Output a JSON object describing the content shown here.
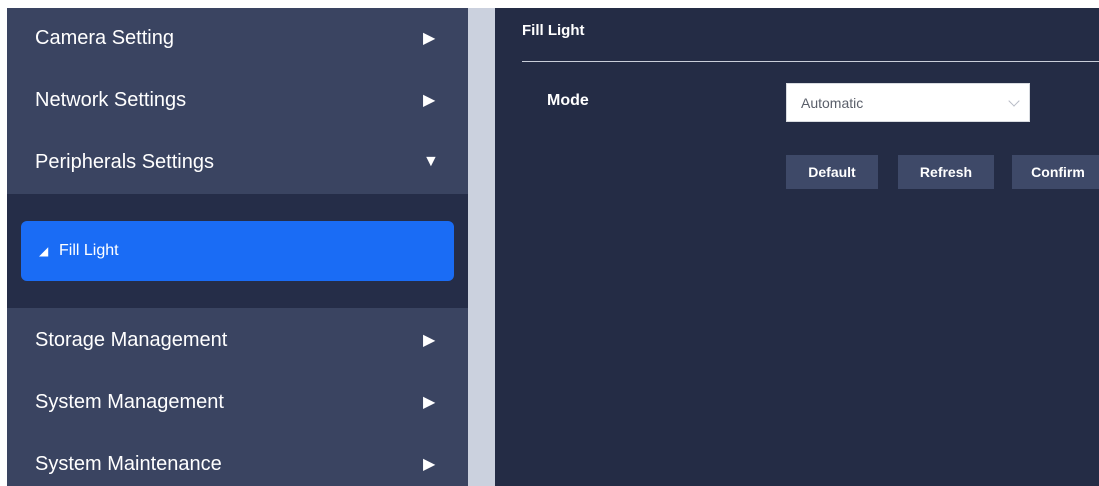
{
  "sidebar": {
    "items": [
      {
        "label": "Camera Setting",
        "arrow": "▶"
      },
      {
        "label": "Network Settings",
        "arrow": "▶"
      },
      {
        "label": "Peripherals Settings",
        "arrow": "▼"
      },
      {
        "label": "Storage Management",
        "arrow": "▶"
      },
      {
        "label": "System Management",
        "arrow": "▶"
      },
      {
        "label": "System Maintenance",
        "arrow": "▶"
      }
    ],
    "submenu": {
      "active": {
        "label": "Fill Light",
        "marker": "◢"
      }
    }
  },
  "main": {
    "title": "Fill Light",
    "mode": {
      "label": "Mode",
      "value": "Automatic"
    },
    "buttons": {
      "default": "Default",
      "refresh": "Refresh",
      "confirm": "Confirm"
    }
  },
  "colors": {
    "sidebar_bg": "#3a4461",
    "submenu_bg": "#252d48",
    "active_item": "#1a6cf5",
    "main_bg": "#242c45",
    "divider": "#cbd1de",
    "button_bg": "#3e4968"
  }
}
